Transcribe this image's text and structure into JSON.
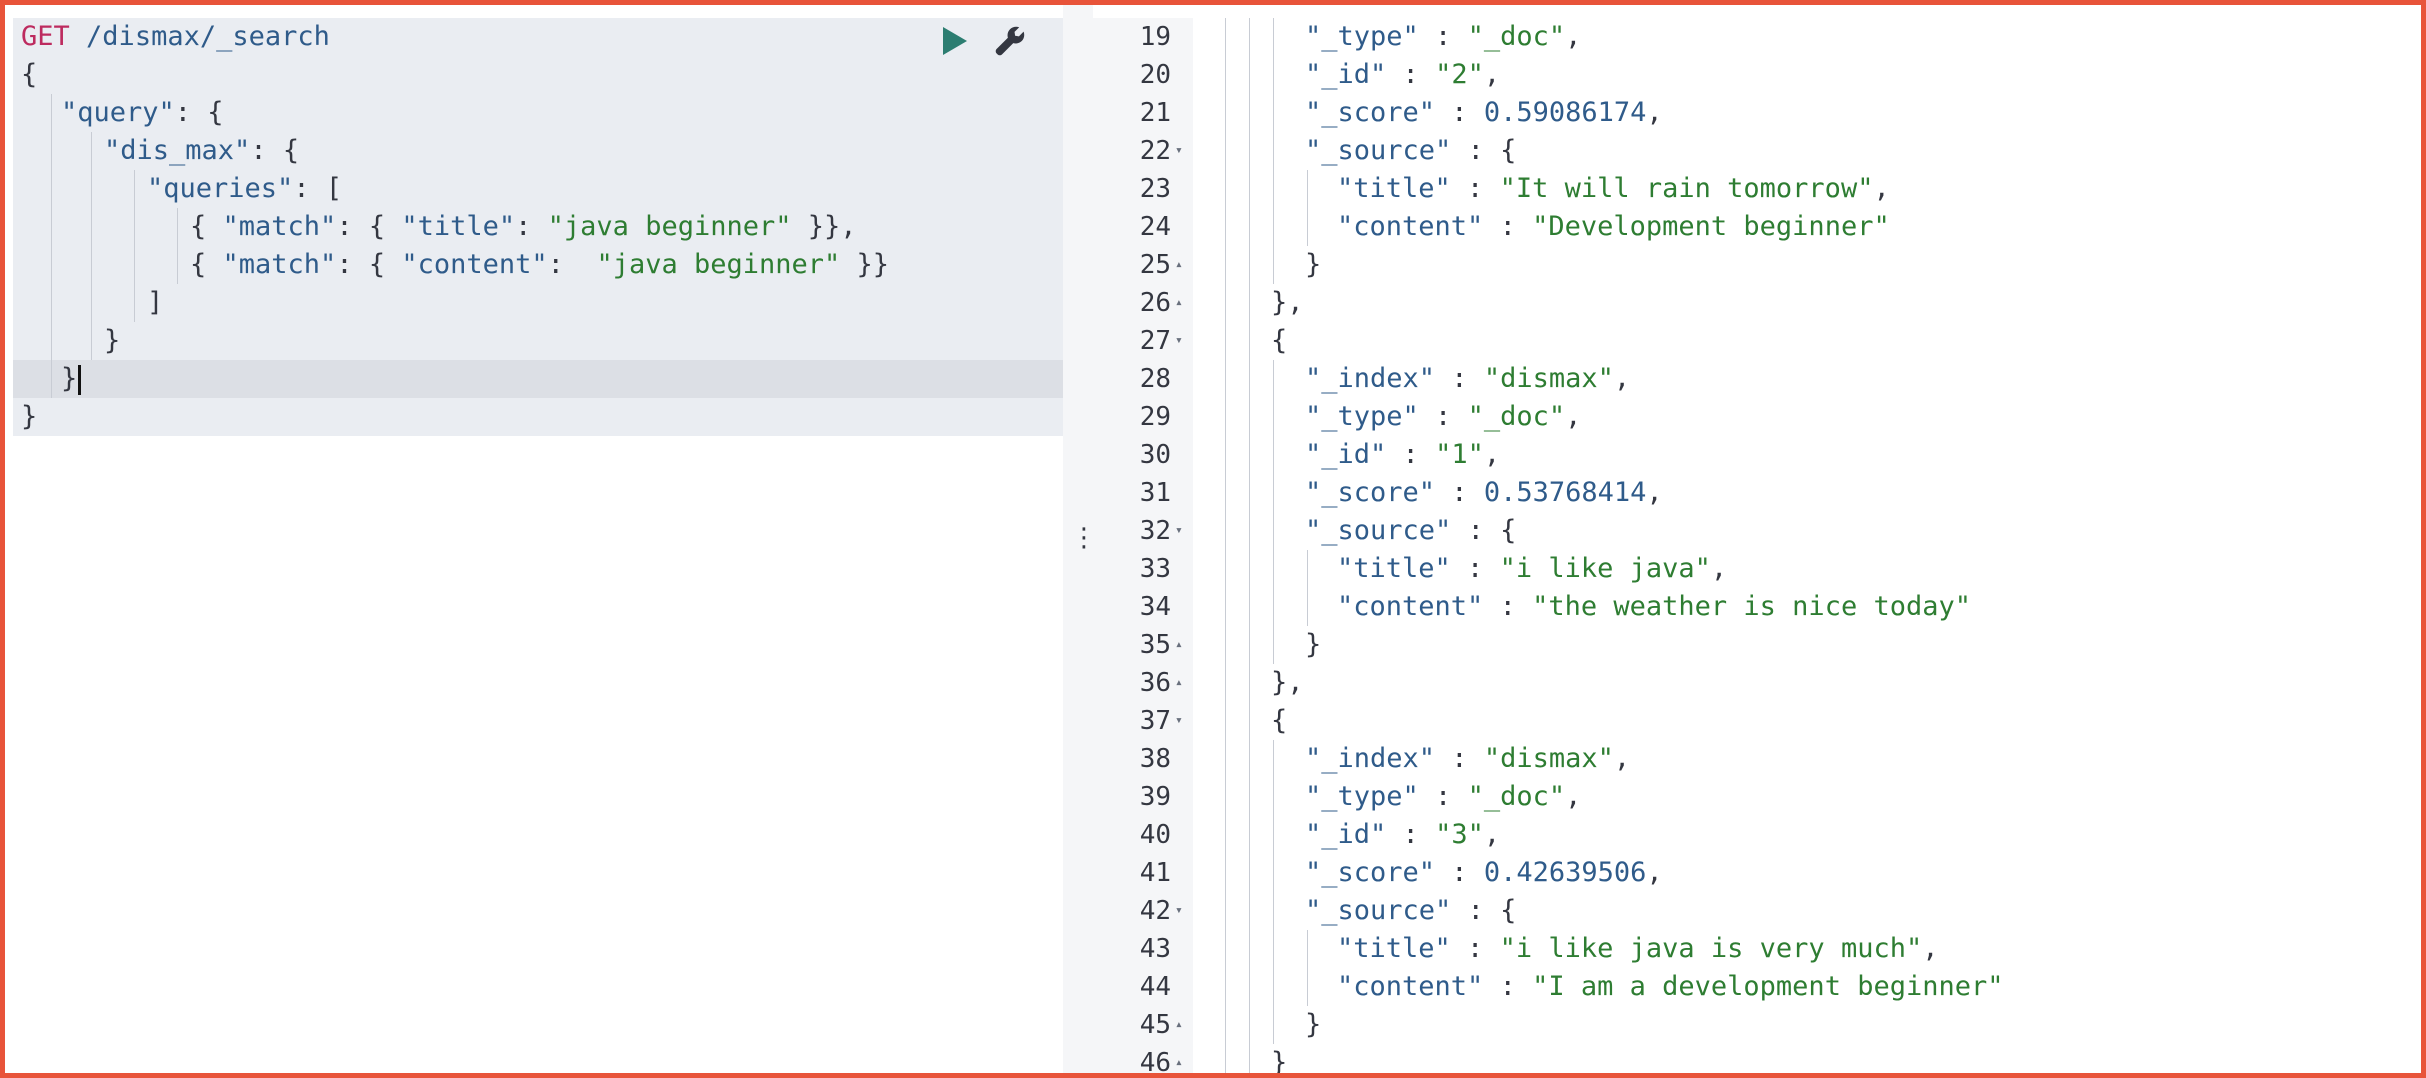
{
  "request": {
    "method": "GET",
    "url": "/dismax/_search",
    "lines": [
      {
        "indent": 0,
        "tokens": [
          [
            "pun",
            "{"
          ]
        ]
      },
      {
        "indent": 1,
        "tokens": [
          [
            "key",
            "\"query\""
          ],
          [
            "pun",
            ": {"
          ]
        ]
      },
      {
        "indent": 2,
        "tokens": [
          [
            "key",
            "\"dis_max\""
          ],
          [
            "pun",
            ": {"
          ]
        ]
      },
      {
        "indent": 3,
        "tokens": [
          [
            "key",
            "\"queries\""
          ],
          [
            "pun",
            ": ["
          ]
        ]
      },
      {
        "indent": 4,
        "tokens": [
          [
            "pun",
            "{ "
          ],
          [
            "key",
            "\"match\""
          ],
          [
            "pun",
            ": { "
          ],
          [
            "key",
            "\"title\""
          ],
          [
            "pun",
            ": "
          ],
          [
            "str",
            "\"java beginner\""
          ],
          [
            "pun",
            " }},"
          ]
        ]
      },
      {
        "indent": 4,
        "tokens": [
          [
            "pun",
            "{ "
          ],
          [
            "key",
            "\"match\""
          ],
          [
            "pun",
            ": { "
          ],
          [
            "key",
            "\"content\""
          ],
          [
            "pun",
            ":  "
          ],
          [
            "str",
            "\"java beginner\""
          ],
          [
            "pun",
            " }}"
          ]
        ]
      },
      {
        "indent": 3,
        "tokens": [
          [
            "pun",
            "]"
          ]
        ]
      },
      {
        "indent": 2,
        "tokens": [
          [
            "pun",
            "}"
          ]
        ]
      },
      {
        "indent": 1,
        "tokens": [
          [
            "pun",
            "}"
          ]
        ],
        "active": true
      },
      {
        "indent": 0,
        "tokens": [
          [
            "pun",
            "}"
          ]
        ]
      }
    ]
  },
  "actions": {
    "run_icon": "play-icon",
    "settings_icon": "wrench-icon"
  },
  "response": {
    "lines": [
      {
        "n": "19",
        "fold": "",
        "indent": 3,
        "tokens": [
          [
            "key",
            "\"_type\""
          ],
          [
            "pun",
            " : "
          ],
          [
            "str",
            "\"_doc\""
          ],
          [
            "pun",
            ","
          ]
        ]
      },
      {
        "n": "20",
        "fold": "",
        "indent": 3,
        "tokens": [
          [
            "key",
            "\"_id\""
          ],
          [
            "pun",
            " : "
          ],
          [
            "str",
            "\"2\""
          ],
          [
            "pun",
            ","
          ]
        ]
      },
      {
        "n": "21",
        "fold": "",
        "indent": 3,
        "tokens": [
          [
            "key",
            "\"_score\""
          ],
          [
            "pun",
            " : "
          ],
          [
            "num",
            "0.59086174"
          ],
          [
            "pun",
            ","
          ]
        ]
      },
      {
        "n": "22",
        "fold": "▾",
        "indent": 3,
        "tokens": [
          [
            "key",
            "\"_source\""
          ],
          [
            "pun",
            " : {"
          ]
        ]
      },
      {
        "n": "23",
        "fold": "",
        "indent": 4,
        "tokens": [
          [
            "key",
            "\"title\""
          ],
          [
            "pun",
            " : "
          ],
          [
            "str",
            "\"It will rain tomorrow\""
          ],
          [
            "pun",
            ","
          ]
        ]
      },
      {
        "n": "24",
        "fold": "",
        "indent": 4,
        "tokens": [
          [
            "key",
            "\"content\""
          ],
          [
            "pun",
            " : "
          ],
          [
            "str",
            "\"Development beginner\""
          ]
        ]
      },
      {
        "n": "25",
        "fold": "▴",
        "indent": 3,
        "tokens": [
          [
            "pun",
            "}"
          ]
        ]
      },
      {
        "n": "26",
        "fold": "▴",
        "indent": 2,
        "tokens": [
          [
            "pun",
            "},"
          ]
        ]
      },
      {
        "n": "27",
        "fold": "▾",
        "indent": 2,
        "tokens": [
          [
            "pun",
            "{"
          ]
        ]
      },
      {
        "n": "28",
        "fold": "",
        "indent": 3,
        "tokens": [
          [
            "key",
            "\"_index\""
          ],
          [
            "pun",
            " : "
          ],
          [
            "str",
            "\"dismax\""
          ],
          [
            "pun",
            ","
          ]
        ]
      },
      {
        "n": "29",
        "fold": "",
        "indent": 3,
        "tokens": [
          [
            "key",
            "\"_type\""
          ],
          [
            "pun",
            " : "
          ],
          [
            "str",
            "\"_doc\""
          ],
          [
            "pun",
            ","
          ]
        ]
      },
      {
        "n": "30",
        "fold": "",
        "indent": 3,
        "tokens": [
          [
            "key",
            "\"_id\""
          ],
          [
            "pun",
            " : "
          ],
          [
            "str",
            "\"1\""
          ],
          [
            "pun",
            ","
          ]
        ]
      },
      {
        "n": "31",
        "fold": "",
        "indent": 3,
        "tokens": [
          [
            "key",
            "\"_score\""
          ],
          [
            "pun",
            " : "
          ],
          [
            "num",
            "0.53768414"
          ],
          [
            "pun",
            ","
          ]
        ]
      },
      {
        "n": "32",
        "fold": "▾",
        "indent": 3,
        "tokens": [
          [
            "key",
            "\"_source\""
          ],
          [
            "pun",
            " : {"
          ]
        ]
      },
      {
        "n": "33",
        "fold": "",
        "indent": 4,
        "tokens": [
          [
            "key",
            "\"title\""
          ],
          [
            "pun",
            " : "
          ],
          [
            "str",
            "\"i like java\""
          ],
          [
            "pun",
            ","
          ]
        ]
      },
      {
        "n": "34",
        "fold": "",
        "indent": 4,
        "tokens": [
          [
            "key",
            "\"content\""
          ],
          [
            "pun",
            " : "
          ],
          [
            "str",
            "\"the weather is nice today\""
          ]
        ]
      },
      {
        "n": "35",
        "fold": "▴",
        "indent": 3,
        "tokens": [
          [
            "pun",
            "}"
          ]
        ]
      },
      {
        "n": "36",
        "fold": "▴",
        "indent": 2,
        "tokens": [
          [
            "pun",
            "},"
          ]
        ]
      },
      {
        "n": "37",
        "fold": "▾",
        "indent": 2,
        "tokens": [
          [
            "pun",
            "{"
          ]
        ]
      },
      {
        "n": "38",
        "fold": "",
        "indent": 3,
        "tokens": [
          [
            "key",
            "\"_index\""
          ],
          [
            "pun",
            " : "
          ],
          [
            "str",
            "\"dismax\""
          ],
          [
            "pun",
            ","
          ]
        ]
      },
      {
        "n": "39",
        "fold": "",
        "indent": 3,
        "tokens": [
          [
            "key",
            "\"_type\""
          ],
          [
            "pun",
            " : "
          ],
          [
            "str",
            "\"_doc\""
          ],
          [
            "pun",
            ","
          ]
        ]
      },
      {
        "n": "40",
        "fold": "",
        "indent": 3,
        "tokens": [
          [
            "key",
            "\"_id\""
          ],
          [
            "pun",
            " : "
          ],
          [
            "str",
            "\"3\""
          ],
          [
            "pun",
            ","
          ]
        ]
      },
      {
        "n": "41",
        "fold": "",
        "indent": 3,
        "tokens": [
          [
            "key",
            "\"_score\""
          ],
          [
            "pun",
            " : "
          ],
          [
            "num",
            "0.42639506"
          ],
          [
            "pun",
            ","
          ]
        ]
      },
      {
        "n": "42",
        "fold": "▾",
        "indent": 3,
        "tokens": [
          [
            "key",
            "\"_source\""
          ],
          [
            "pun",
            " : {"
          ]
        ]
      },
      {
        "n": "43",
        "fold": "",
        "indent": 4,
        "tokens": [
          [
            "key",
            "\"title\""
          ],
          [
            "pun",
            " : "
          ],
          [
            "str",
            "\"i like java is very much\""
          ],
          [
            "pun",
            ","
          ]
        ]
      },
      {
        "n": "44",
        "fold": "",
        "indent": 4,
        "tokens": [
          [
            "key",
            "\"content\""
          ],
          [
            "pun",
            " : "
          ],
          [
            "str",
            "\"I am a development beginner\""
          ]
        ]
      },
      {
        "n": "45",
        "fold": "▴",
        "indent": 3,
        "tokens": [
          [
            "pun",
            "}"
          ]
        ]
      },
      {
        "n": "46",
        "fold": "▴",
        "indent": 2,
        "tokens": [
          [
            "pun",
            "}"
          ]
        ]
      }
    ]
  },
  "splitter": {
    "handle": "⋮"
  },
  "colors": {
    "frame_border": "#e8543a",
    "method": "#bd2b5f",
    "key": "#2f5b8a",
    "string": "#2e7d32",
    "play": "#2c7d71"
  }
}
